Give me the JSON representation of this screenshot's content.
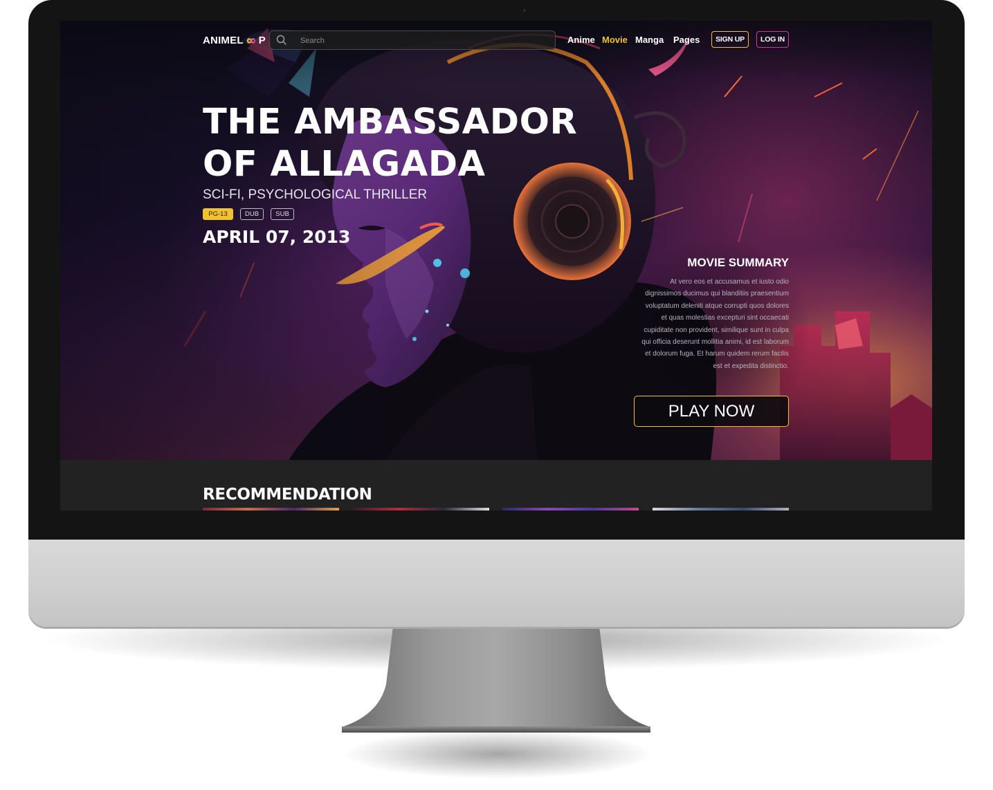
{
  "nav": {
    "logo_text_before": "ANIMEL",
    "logo_text_after": "P",
    "search_placeholder": "Search",
    "links": [
      "Anime",
      "Movie",
      "Manga",
      "Pages"
    ],
    "active_link": "Movie",
    "signup_label": "SIGN UP",
    "login_label": "LOG IN"
  },
  "hero": {
    "title_line1": "THE AMBASSADOR",
    "title_line2": "OF ALLAGADA",
    "genre": "SCI-FI, PSYCHOLOGICAL THRILLER",
    "badges": [
      "PG-13",
      "DUB",
      "SUB"
    ],
    "release_date": "APRIL 07, 2013",
    "summary_title": "MOVIE SUMMARY",
    "summary_text": "At vero eos et accusamus et iusto odio dignissimos ducimus qui blanditiis praesentium voluptatum deleniti atque corrupti quos dolores et quas molestias excepturi sint occaecati cupiditate non provident, similique sunt in culpa qui officia deserunt mollitia animi, id est laborum et dolorum fuga. Et harum quidem rerum facilis est et expedita distinctio.",
    "play_label": "PLAY NOW"
  },
  "recommendation": {
    "heading": "RECOMMENDATION"
  },
  "colors": {
    "accent_yellow": "#f2c230",
    "accent_pink": "#cf3b9b",
    "band_dark": "#222223"
  },
  "icons": {
    "search": "search-icon",
    "logo_loop": "infinity-loop-icon"
  }
}
